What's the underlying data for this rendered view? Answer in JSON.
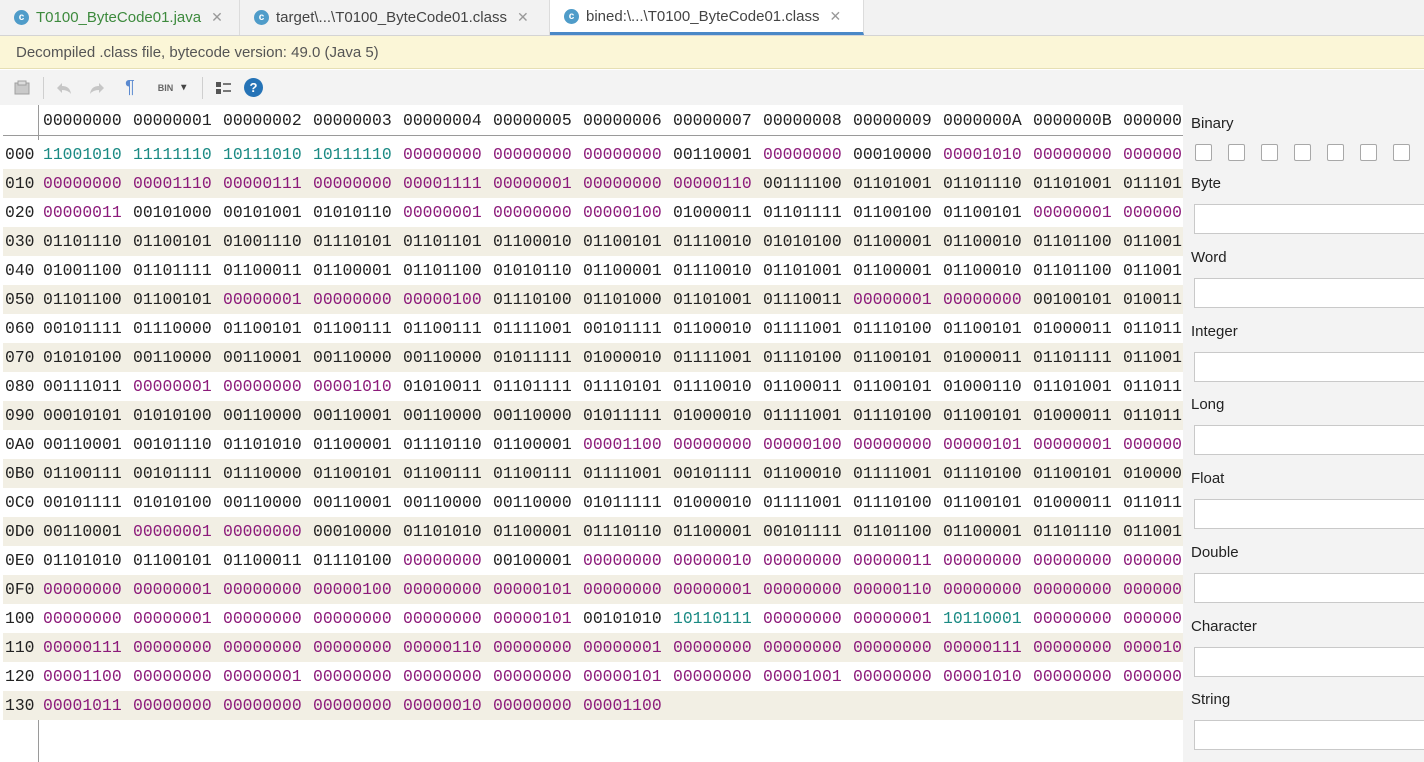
{
  "tabs": [
    {
      "icon": "c",
      "label": "T0100_ByteCode01.java",
      "active": false
    },
    {
      "icon": "c",
      "label": "target\\...\\T0100_ByteCode01.class",
      "active": false
    },
    {
      "icon": "c",
      "label": "bined:\\...\\T0100_ByteCode01.class",
      "active": true
    }
  ],
  "tab_close": "✕",
  "banner": "Decompiled .class file, bytecode version: 49.0 (Java 5)",
  "toolbar": {
    "icons": [
      "export-icon",
      "undo-icon",
      "redo-icon",
      "show-unprintables-icon",
      "code-type-icon",
      "layout-icon",
      "help-icon"
    ],
    "bin_label": "BIN",
    "bin_caret": "▾",
    "para": "¶",
    "help": "?"
  },
  "hex_header": [
    "00000000",
    "00000001",
    "00000002",
    "00000003",
    "00000004",
    "00000005",
    "00000006",
    "00000007",
    "00000008",
    "00000009",
    "0000000A",
    "0000000B",
    "0000000"
  ],
  "hex_rows": [
    {
      "addr": "000",
      "cells": [
        "11001010",
        "11111110",
        "10111010",
        "10111110",
        "00000000",
        "00000000",
        "00000000",
        "00110001",
        "00000000",
        "00010000",
        "00001010",
        "00000000",
        "000000"
      ]
    },
    {
      "addr": "010",
      "cells": [
        "00000000",
        "00001110",
        "00000111",
        "00000000",
        "00001111",
        "00000001",
        "00000000",
        "00000110",
        "00111100",
        "01101001",
        "01101110",
        "01101001",
        "011101"
      ]
    },
    {
      "addr": "020",
      "cells": [
        "00000011",
        "00101000",
        "00101001",
        "01010110",
        "00000001",
        "00000000",
        "00000100",
        "01000011",
        "01101111",
        "01100100",
        "01100101",
        "00000001",
        "000000"
      ]
    },
    {
      "addr": "030",
      "cells": [
        "01101110",
        "01100101",
        "01001110",
        "01110101",
        "01101101",
        "01100010",
        "01100101",
        "01110010",
        "01010100",
        "01100001",
        "01100010",
        "01101100",
        "011001"
      ]
    },
    {
      "addr": "040",
      "cells": [
        "01001100",
        "01101111",
        "01100011",
        "01100001",
        "01101100",
        "01010110",
        "01100001",
        "01110010",
        "01101001",
        "01100001",
        "01100010",
        "01101100",
        "011001"
      ]
    },
    {
      "addr": "050",
      "cells": [
        "01101100",
        "01100101",
        "00000001",
        "00000000",
        "00000100",
        "01110100",
        "01101000",
        "01101001",
        "01110011",
        "00000001",
        "00000000",
        "00100101",
        "010011"
      ]
    },
    {
      "addr": "060",
      "cells": [
        "00101111",
        "01110000",
        "01100101",
        "01100111",
        "01100111",
        "01111001",
        "00101111",
        "01100010",
        "01111001",
        "01110100",
        "01100101",
        "01000011",
        "011011"
      ]
    },
    {
      "addr": "070",
      "cells": [
        "01010100",
        "00110000",
        "00110001",
        "00110000",
        "00110000",
        "01011111",
        "01000010",
        "01111001",
        "01110100",
        "01100101",
        "01000011",
        "01101111",
        "011001"
      ]
    },
    {
      "addr": "080",
      "cells": [
        "00111011",
        "00000001",
        "00000000",
        "00001010",
        "01010011",
        "01101111",
        "01110101",
        "01110010",
        "01100011",
        "01100101",
        "01000110",
        "01101001",
        "011011"
      ]
    },
    {
      "addr": "090",
      "cells": [
        "00010101",
        "01010100",
        "00110000",
        "00110001",
        "00110000",
        "00110000",
        "01011111",
        "01000010",
        "01111001",
        "01110100",
        "01100101",
        "01000011",
        "011011"
      ]
    },
    {
      "addr": "0A0",
      "cells": [
        "00110001",
        "00101110",
        "01101010",
        "01100001",
        "01110110",
        "01100001",
        "00001100",
        "00000000",
        "00000100",
        "00000000",
        "00000101",
        "00000001",
        "000000"
      ]
    },
    {
      "addr": "0B0",
      "cells": [
        "01100111",
        "00101111",
        "01110000",
        "01100101",
        "01100111",
        "01100111",
        "01111001",
        "00101111",
        "01100010",
        "01111001",
        "01110100",
        "01100101",
        "010000"
      ]
    },
    {
      "addr": "0C0",
      "cells": [
        "00101111",
        "01010100",
        "00110000",
        "00110001",
        "00110000",
        "00110000",
        "01011111",
        "01000010",
        "01111001",
        "01110100",
        "01100101",
        "01000011",
        "011011"
      ]
    },
    {
      "addr": "0D0",
      "cells": [
        "00110001",
        "00000001",
        "00000000",
        "00010000",
        "01101010",
        "01100001",
        "01110110",
        "01100001",
        "00101111",
        "01101100",
        "01100001",
        "01101110",
        "011001"
      ]
    },
    {
      "addr": "0E0",
      "cells": [
        "01101010",
        "01100101",
        "01100011",
        "01110100",
        "00000000",
        "00100001",
        "00000000",
        "00000010",
        "00000000",
        "00000011",
        "00000000",
        "00000000",
        "000000"
      ]
    },
    {
      "addr": "0F0",
      "cells": [
        "00000000",
        "00000001",
        "00000000",
        "00000100",
        "00000000",
        "00000101",
        "00000000",
        "00000001",
        "00000000",
        "00000110",
        "00000000",
        "00000000",
        "000000"
      ]
    },
    {
      "addr": "100",
      "cells": [
        "00000000",
        "00000001",
        "00000000",
        "00000000",
        "00000000",
        "00000101",
        "00101010",
        "10110111",
        "00000000",
        "00000001",
        "10110001",
        "00000000",
        "000000"
      ]
    },
    {
      "addr": "110",
      "cells": [
        "00000111",
        "00000000",
        "00000000",
        "00000000",
        "00000110",
        "00000000",
        "00000001",
        "00000000",
        "00000000",
        "00000000",
        "00000111",
        "00000000",
        "000010"
      ]
    },
    {
      "addr": "120",
      "cells": [
        "00001100",
        "00000000",
        "00000001",
        "00000000",
        "00000000",
        "00000000",
        "00000101",
        "00000000",
        "00001001",
        "00000000",
        "00001010",
        "00000000",
        "000000"
      ]
    },
    {
      "addr": "130",
      "cells": [
        "00001011",
        "00000000",
        "00000000",
        "00000000",
        "00000010",
        "00000000",
        "00001100"
      ]
    }
  ],
  "colors": {
    "normal": "#222222",
    "zero_byte": "#8c1a7a",
    "selected_ish": "#1a8a83",
    "row_alt": "#f2efe4",
    "banner_bg": "#fbf6d7"
  },
  "panel": {
    "binary_label": "Binary",
    "byte_label": "Byte",
    "word_label": "Word",
    "integer_label": "Integer",
    "long_label": "Long",
    "float_label": "Float",
    "double_label": "Double",
    "character_label": "Character",
    "string_label": "String"
  }
}
